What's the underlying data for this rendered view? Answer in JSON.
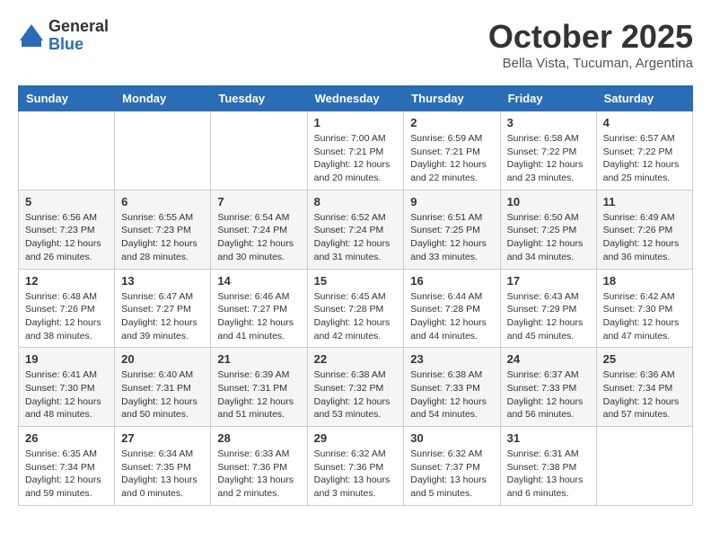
{
  "logo": {
    "general": "General",
    "blue": "Blue"
  },
  "title": "October 2025",
  "location": "Bella Vista, Tucuman, Argentina",
  "days_of_week": [
    "Sunday",
    "Monday",
    "Tuesday",
    "Wednesday",
    "Thursday",
    "Friday",
    "Saturday"
  ],
  "weeks": [
    [
      {
        "day": "",
        "info": ""
      },
      {
        "day": "",
        "info": ""
      },
      {
        "day": "",
        "info": ""
      },
      {
        "day": "1",
        "info": "Sunrise: 7:00 AM\nSunset: 7:21 PM\nDaylight: 12 hours\nand 20 minutes."
      },
      {
        "day": "2",
        "info": "Sunrise: 6:59 AM\nSunset: 7:21 PM\nDaylight: 12 hours\nand 22 minutes."
      },
      {
        "day": "3",
        "info": "Sunrise: 6:58 AM\nSunset: 7:22 PM\nDaylight: 12 hours\nand 23 minutes."
      },
      {
        "day": "4",
        "info": "Sunrise: 6:57 AM\nSunset: 7:22 PM\nDaylight: 12 hours\nand 25 minutes."
      }
    ],
    [
      {
        "day": "5",
        "info": "Sunrise: 6:56 AM\nSunset: 7:23 PM\nDaylight: 12 hours\nand 26 minutes."
      },
      {
        "day": "6",
        "info": "Sunrise: 6:55 AM\nSunset: 7:23 PM\nDaylight: 12 hours\nand 28 minutes."
      },
      {
        "day": "7",
        "info": "Sunrise: 6:54 AM\nSunset: 7:24 PM\nDaylight: 12 hours\nand 30 minutes."
      },
      {
        "day": "8",
        "info": "Sunrise: 6:52 AM\nSunset: 7:24 PM\nDaylight: 12 hours\nand 31 minutes."
      },
      {
        "day": "9",
        "info": "Sunrise: 6:51 AM\nSunset: 7:25 PM\nDaylight: 12 hours\nand 33 minutes."
      },
      {
        "day": "10",
        "info": "Sunrise: 6:50 AM\nSunset: 7:25 PM\nDaylight: 12 hours\nand 34 minutes."
      },
      {
        "day": "11",
        "info": "Sunrise: 6:49 AM\nSunset: 7:26 PM\nDaylight: 12 hours\nand 36 minutes."
      }
    ],
    [
      {
        "day": "12",
        "info": "Sunrise: 6:48 AM\nSunset: 7:26 PM\nDaylight: 12 hours\nand 38 minutes."
      },
      {
        "day": "13",
        "info": "Sunrise: 6:47 AM\nSunset: 7:27 PM\nDaylight: 12 hours\nand 39 minutes."
      },
      {
        "day": "14",
        "info": "Sunrise: 6:46 AM\nSunset: 7:27 PM\nDaylight: 12 hours\nand 41 minutes."
      },
      {
        "day": "15",
        "info": "Sunrise: 6:45 AM\nSunset: 7:28 PM\nDaylight: 12 hours\nand 42 minutes."
      },
      {
        "day": "16",
        "info": "Sunrise: 6:44 AM\nSunset: 7:28 PM\nDaylight: 12 hours\nand 44 minutes."
      },
      {
        "day": "17",
        "info": "Sunrise: 6:43 AM\nSunset: 7:29 PM\nDaylight: 12 hours\nand 45 minutes."
      },
      {
        "day": "18",
        "info": "Sunrise: 6:42 AM\nSunset: 7:30 PM\nDaylight: 12 hours\nand 47 minutes."
      }
    ],
    [
      {
        "day": "19",
        "info": "Sunrise: 6:41 AM\nSunset: 7:30 PM\nDaylight: 12 hours\nand 48 minutes."
      },
      {
        "day": "20",
        "info": "Sunrise: 6:40 AM\nSunset: 7:31 PM\nDaylight: 12 hours\nand 50 minutes."
      },
      {
        "day": "21",
        "info": "Sunrise: 6:39 AM\nSunset: 7:31 PM\nDaylight: 12 hours\nand 51 minutes."
      },
      {
        "day": "22",
        "info": "Sunrise: 6:38 AM\nSunset: 7:32 PM\nDaylight: 12 hours\nand 53 minutes."
      },
      {
        "day": "23",
        "info": "Sunrise: 6:38 AM\nSunset: 7:33 PM\nDaylight: 12 hours\nand 54 minutes."
      },
      {
        "day": "24",
        "info": "Sunrise: 6:37 AM\nSunset: 7:33 PM\nDaylight: 12 hours\nand 56 minutes."
      },
      {
        "day": "25",
        "info": "Sunrise: 6:36 AM\nSunset: 7:34 PM\nDaylight: 12 hours\nand 57 minutes."
      }
    ],
    [
      {
        "day": "26",
        "info": "Sunrise: 6:35 AM\nSunset: 7:34 PM\nDaylight: 12 hours\nand 59 minutes."
      },
      {
        "day": "27",
        "info": "Sunrise: 6:34 AM\nSunset: 7:35 PM\nDaylight: 13 hours\nand 0 minutes."
      },
      {
        "day": "28",
        "info": "Sunrise: 6:33 AM\nSunset: 7:36 PM\nDaylight: 13 hours\nand 2 minutes."
      },
      {
        "day": "29",
        "info": "Sunrise: 6:32 AM\nSunset: 7:36 PM\nDaylight: 13 hours\nand 3 minutes."
      },
      {
        "day": "30",
        "info": "Sunrise: 6:32 AM\nSunset: 7:37 PM\nDaylight: 13 hours\nand 5 minutes."
      },
      {
        "day": "31",
        "info": "Sunrise: 6:31 AM\nSunset: 7:38 PM\nDaylight: 13 hours\nand 6 minutes."
      },
      {
        "day": "",
        "info": ""
      }
    ]
  ]
}
